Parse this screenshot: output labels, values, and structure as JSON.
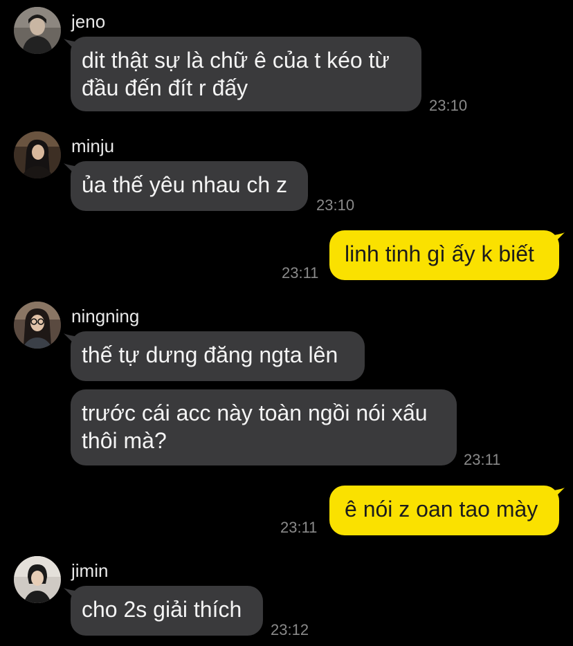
{
  "messages": [
    {
      "sender": "jeno",
      "avatar": "jeno-avatar",
      "bubbles": [
        {
          "text": "dit thật sự là chữ ê của t kéo từ\nđầu đến đít r đấy",
          "time": "23:10"
        }
      ]
    },
    {
      "sender": "minju",
      "avatar": "minju-avatar",
      "bubbles": [
        {
          "text": "ủa thế yêu nhau ch z",
          "time": "23:10"
        }
      ]
    },
    {
      "sender": "me",
      "outgoing": true,
      "bubbles": [
        {
          "text": "linh tinh gì ấy k biết",
          "time": "23:11"
        }
      ]
    },
    {
      "sender": "ningning",
      "avatar": "ningning-avatar",
      "bubbles": [
        {
          "text": "thế tự dưng đăng ngta lên",
          "time": ""
        },
        {
          "text": "trước cái acc này toàn ngồi nói xấu\nthôi mà?",
          "time": "23:11"
        }
      ]
    },
    {
      "sender": "me",
      "outgoing": true,
      "bubbles": [
        {
          "text": "ê nói z oan tao mày",
          "time": "23:11"
        }
      ]
    },
    {
      "sender": "jimin",
      "avatar": "jimin-avatar",
      "bubbles": [
        {
          "text": "cho 2s giải thích",
          "time": "23:12"
        }
      ]
    }
  ],
  "colors": {
    "background": "#000000",
    "incoming_bubble": "#3a3a3c",
    "outgoing_bubble": "#fae100",
    "timestamp": "#8a8a8a"
  }
}
